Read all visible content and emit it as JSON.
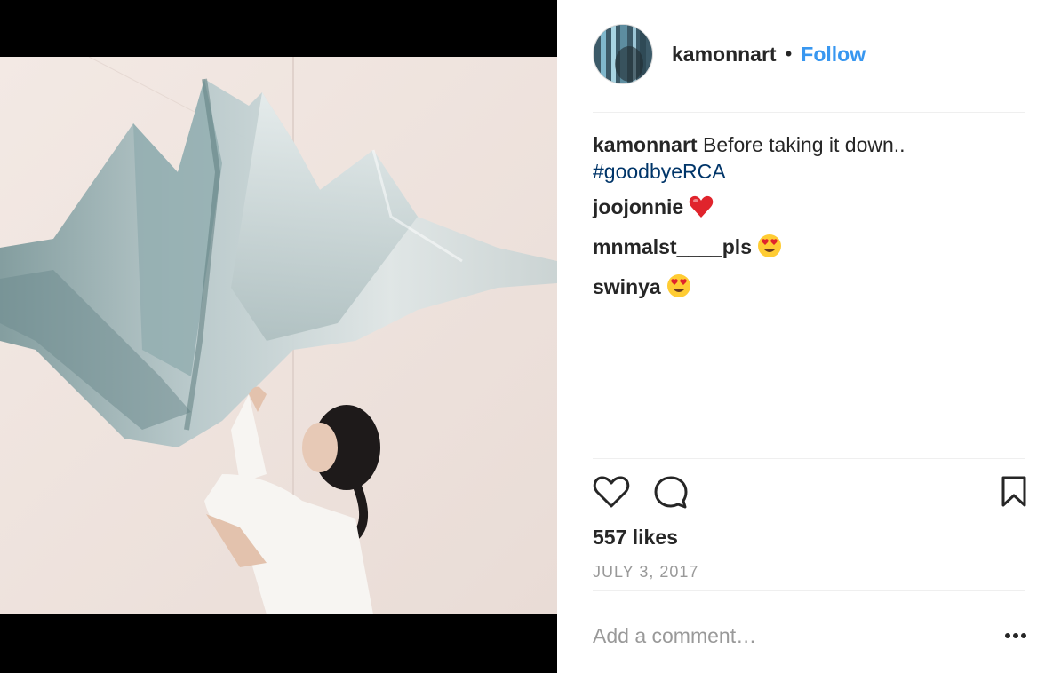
{
  "post": {
    "username": "kamonnart",
    "separator": "•",
    "follow_label": "Follow",
    "likes": "557 likes",
    "date": "JULY 3, 2017"
  },
  "caption": {
    "username": "kamonnart",
    "text": "Before taking it down..",
    "hashtag": "#goodbyeRCA"
  },
  "comments": [
    {
      "username": "joojonnie",
      "emoji": "heart-emoji"
    },
    {
      "username": "mnmalst____pls",
      "emoji": "heart-eyes-emoji"
    },
    {
      "username": "swinya",
      "emoji": "heart-eyes-emoji"
    }
  ],
  "actions": {
    "like_icon": "heart-icon",
    "comment_icon": "comment-icon",
    "save_icon": "bookmark-icon",
    "more_icon": "more-options-icon"
  },
  "comment_form": {
    "placeholder": "Add a comment…"
  },
  "colors": {
    "link_blue": "#3897f0",
    "hashtag_blue": "#003569",
    "muted_gray": "#999999",
    "heart_red": "#e0242c"
  }
}
